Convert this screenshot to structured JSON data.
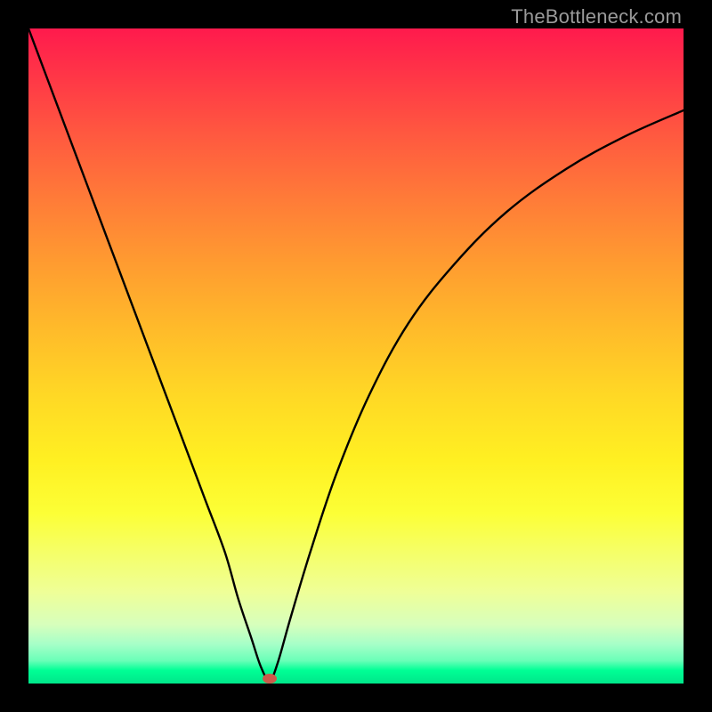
{
  "watermark": "TheBottleneck.com",
  "marker": {
    "cx_pct": 36.8,
    "cy_pct": 99.2
  },
  "chart_data": {
    "type": "line",
    "title": "",
    "xlabel": "",
    "ylabel": "",
    "xlim": [
      0,
      100
    ],
    "ylim": [
      0,
      100
    ],
    "grid": false,
    "background_gradient": {
      "direction": "vertical",
      "stops": [
        {
          "pct": 0,
          "color": "#ff1a4d"
        },
        {
          "pct": 50,
          "color": "#ffd028"
        },
        {
          "pct": 75,
          "color": "#fcff36"
        },
        {
          "pct": 100,
          "color": "#00e68a"
        }
      ]
    },
    "series": [
      {
        "name": "bottleneck-curve",
        "x": [
          0,
          3,
          6,
          9,
          12,
          15,
          18,
          21,
          24,
          27,
          30,
          32,
          34,
          35.5,
          36.8,
          38,
          40,
          43,
          47,
          52,
          58,
          65,
          73,
          82,
          91,
          100
        ],
        "y": [
          100,
          92,
          84,
          76,
          68,
          60,
          52,
          44,
          36,
          28,
          20,
          13,
          7,
          2.5,
          0.5,
          3,
          10,
          20,
          32,
          44,
          55,
          64,
          72,
          78.5,
          83.5,
          87.5
        ]
      }
    ],
    "annotations": [
      {
        "type": "point",
        "name": "optimal",
        "x": 36.8,
        "y": 0.5,
        "color": "#cc5a4a"
      }
    ]
  }
}
